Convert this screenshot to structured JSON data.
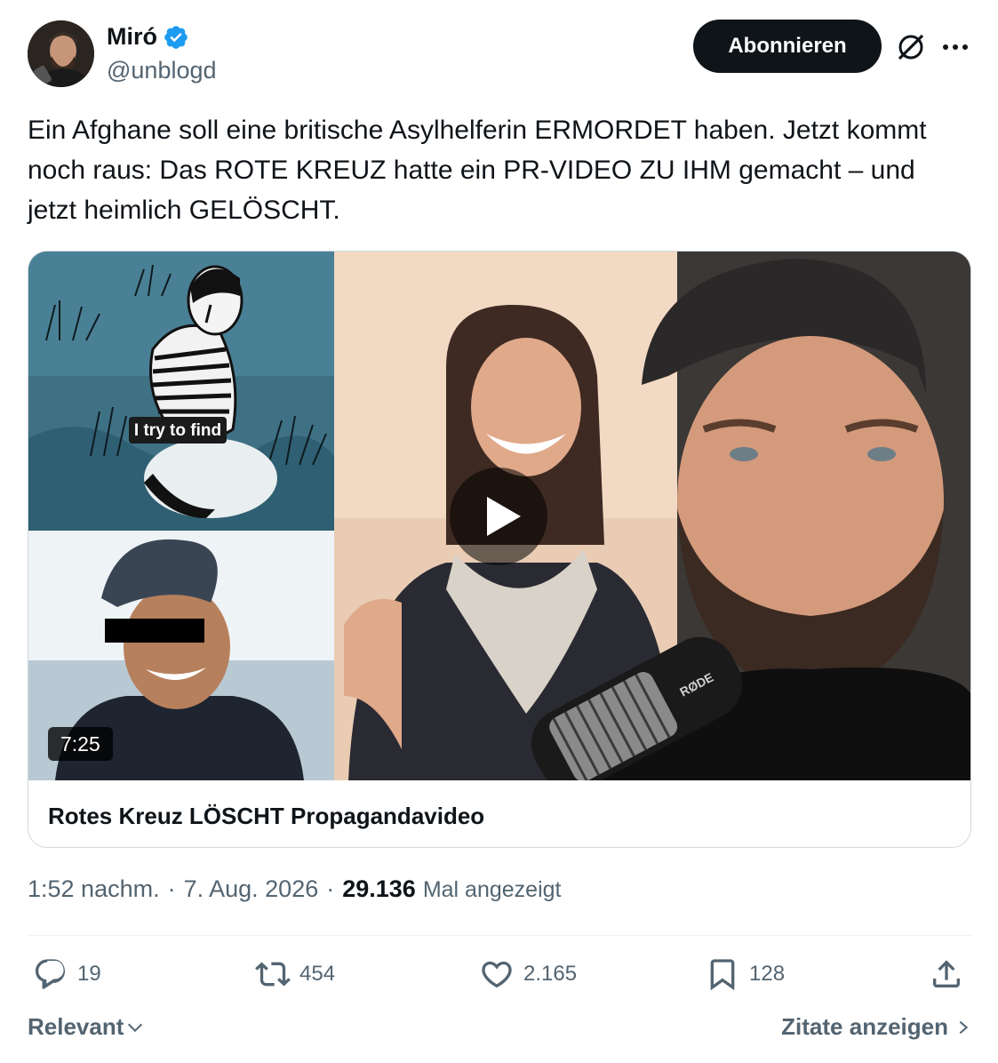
{
  "author": {
    "name": "Miró",
    "handle": "@unblogd",
    "verified": true,
    "verified_color": "#1d9bf0"
  },
  "header": {
    "subscribe_label": "Abonnieren",
    "grok_icon": "grok-icon",
    "more_icon": "more-dots-icon"
  },
  "tweet": {
    "text": "Ein Afghane soll eine britische Asylhelferin ERMORDET haben. Jetzt kommt noch raus: Das ROTE KREUZ hatte ein PR-VIDEO ZU IHM gemacht – und jetzt heimlich GELÖSCHT."
  },
  "card": {
    "video_duration": "7:25",
    "thumbnail_caption": "I try to find",
    "title": "Rotes Kreuz LÖSCHT Propagandavideo",
    "mic_brand": "RØDE"
  },
  "meta": {
    "time": "1:52 nachm.",
    "separator": "·",
    "date": "7. Aug. 2026",
    "views_count": "29.136",
    "views_label": "Mal angezeigt"
  },
  "actions": {
    "replies": "19",
    "reposts": "454",
    "likes": "2.165",
    "bookmarks": "128"
  },
  "footer": {
    "sort_label": "Relevant",
    "quotes_label": "Zitate anzeigen"
  },
  "colors": {
    "text_primary": "#0f1419",
    "text_secondary": "#536471",
    "border": "#cfd9de",
    "button_bg": "#0f1419"
  }
}
